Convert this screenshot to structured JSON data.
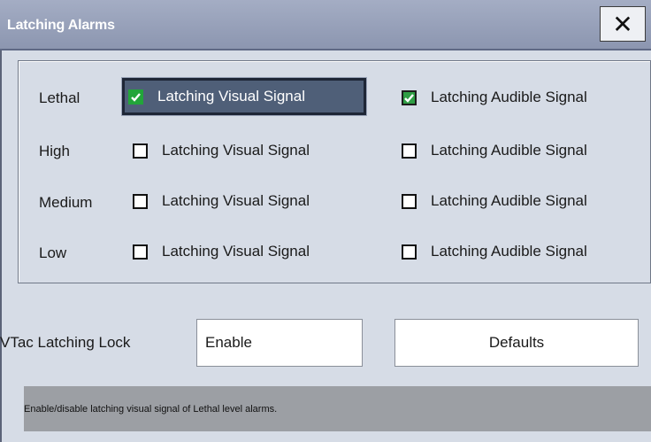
{
  "dialog": {
    "title": "Latching Alarms",
    "close_label": "✕"
  },
  "levels": [
    {
      "name": "Lethal",
      "visual": {
        "label": "Latching Visual Signal",
        "checked": true,
        "focused": true
      },
      "audible": {
        "label": "Latching Audible Signal",
        "checked": true
      }
    },
    {
      "name": "High",
      "visual": {
        "label": "Latching Visual Signal",
        "checked": false
      },
      "audible": {
        "label": "Latching Audible Signal",
        "checked": false
      }
    },
    {
      "name": "Medium",
      "visual": {
        "label": "Latching Visual Signal",
        "checked": false
      },
      "audible": {
        "label": "Latching Audible Signal",
        "checked": false
      }
    },
    {
      "name": "Low",
      "visual": {
        "label": "Latching Visual Signal",
        "checked": false
      },
      "audible": {
        "label": "Latching Audible Signal",
        "checked": false
      }
    }
  ],
  "vtac": {
    "label": "VTac Latching Lock",
    "value": "Enable"
  },
  "defaults_label": "Defaults",
  "status_text": "Enable/disable latching visual signal of Lethal level alarms.",
  "colors": {
    "background": "#d6dce6",
    "titlebar": "#98a2bb",
    "check": "#22a53a",
    "focus": "#4f5f78"
  }
}
